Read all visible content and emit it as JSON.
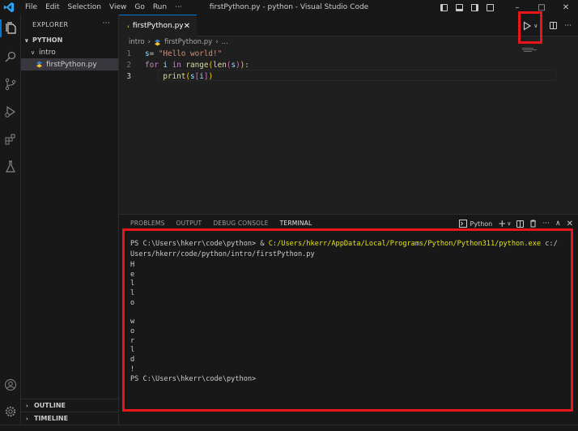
{
  "window": {
    "title": "firstPython.py - python - Visual Studio Code",
    "menu": [
      "File",
      "Edit",
      "Selection",
      "View",
      "Go",
      "Run",
      "···"
    ]
  },
  "sidebar": {
    "header": "EXPLORER",
    "more": "···",
    "tree": [
      {
        "label": "PYTHON",
        "kind": "root"
      },
      {
        "label": "intro",
        "kind": "folder"
      },
      {
        "label": "firstPython.py",
        "kind": "file",
        "selected": true
      }
    ],
    "outline": "OUTLINE",
    "timeline": "TIMELINE"
  },
  "editor": {
    "tab_label": "firstPython.py",
    "tab_close": "✕",
    "breadcrumb": [
      "intro",
      "›",
      "firstPython.py",
      "›",
      "..."
    ],
    "lines": [
      {
        "n": "1",
        "tokens": [
          [
            "v",
            "s"
          ],
          [
            "p",
            "= "
          ],
          [
            "s",
            "\"Hello world!\""
          ]
        ]
      },
      {
        "n": "2",
        "tokens": [
          [
            "k",
            "for"
          ],
          [
            "p",
            " "
          ],
          [
            "v",
            "i"
          ],
          [
            "p",
            " "
          ],
          [
            "k",
            "in"
          ],
          [
            "p",
            " "
          ],
          [
            "f",
            "range"
          ],
          [
            "b1",
            "("
          ],
          [
            "f",
            "len"
          ],
          [
            "b2",
            "("
          ],
          [
            "v",
            "s"
          ],
          [
            "b2",
            ")"
          ],
          [
            "b1",
            ")"
          ],
          [
            "p",
            ":"
          ]
        ]
      },
      {
        "n": "3",
        "tokens": [
          [
            "p",
            "    "
          ],
          [
            "f",
            "print"
          ],
          [
            "b1",
            "("
          ],
          [
            "v",
            "s"
          ],
          [
            "b2",
            "["
          ],
          [
            "v",
            "i"
          ],
          [
            "b2",
            "]"
          ],
          [
            "b1",
            ")"
          ]
        ]
      }
    ],
    "current_line": 3
  },
  "panel": {
    "tabs": [
      "PROBLEMS",
      "OUTPUT",
      "DEBUG CONSOLE",
      "TERMINAL"
    ],
    "active_tab": "TERMINAL",
    "terminal_profile": "Python",
    "more": "···"
  },
  "terminal": {
    "prompt1": "PS C:\\Users\\hkerr\\code\\python> ",
    "command_amp": "& ",
    "command_exe": "C:/Users/hkerr/AppData/Local/Programs/Python/Python311/python.exe",
    "command_arg1": " c:/",
    "command_arg2": "Users/hkerr/code/python/intro/firstPython.py",
    "output": [
      "H",
      "e",
      "l",
      "l",
      "o",
      " ",
      "w",
      "o",
      "r",
      "l",
      "d",
      "!"
    ],
    "prompt2": "PS C:\\Users\\hkerr\\code\\python>"
  },
  "colors": {
    "accent": "#0078d4",
    "highlight_box": "#e8161a",
    "terminal_path_yellow": "#e5e510"
  }
}
